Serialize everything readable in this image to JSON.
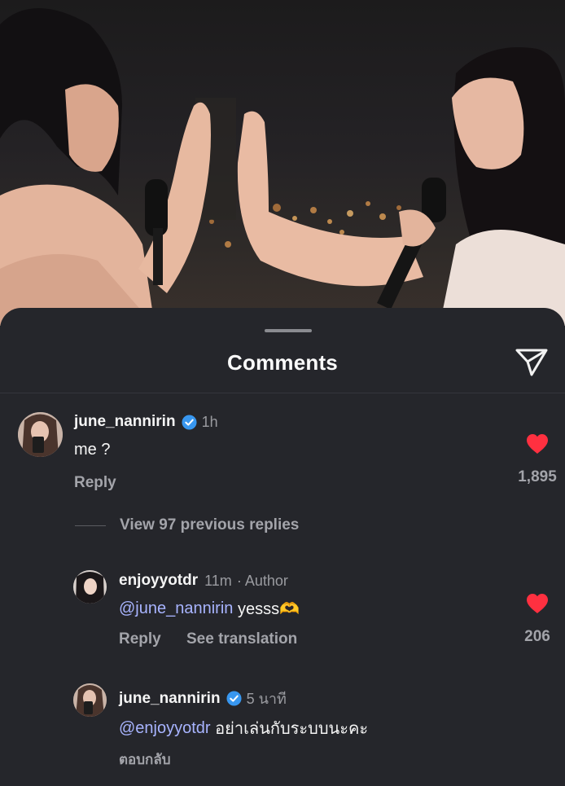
{
  "sheet": {
    "title": "Comments",
    "share_icon": "send-icon"
  },
  "comment": {
    "username": "june_nannirin",
    "verified": true,
    "time": "1h",
    "text": "me ?",
    "reply_label": "Reply",
    "likes": "1,895",
    "liked": true
  },
  "view_replies": "View 97 previous replies",
  "replies": [
    {
      "username": "enjoyyotdr",
      "time": "11m",
      "badge": "· Author",
      "mention": "@june_nannirin",
      "text": " yesss🫶",
      "reply_label": "Reply",
      "translate_label": "See translation",
      "likes": "206",
      "liked": true
    },
    {
      "username": "june_nannirin",
      "verified": true,
      "time": "5 นาที",
      "mention": "@enjoyyotdr",
      "text": " อย่าเล่นกับระบบนะคะ",
      "reply_label": "ตอบกลับ"
    }
  ],
  "colors": {
    "heart": "#ff3040",
    "mention": "#a8b4ff",
    "verified": "#3897f0",
    "background": "#25262b"
  }
}
